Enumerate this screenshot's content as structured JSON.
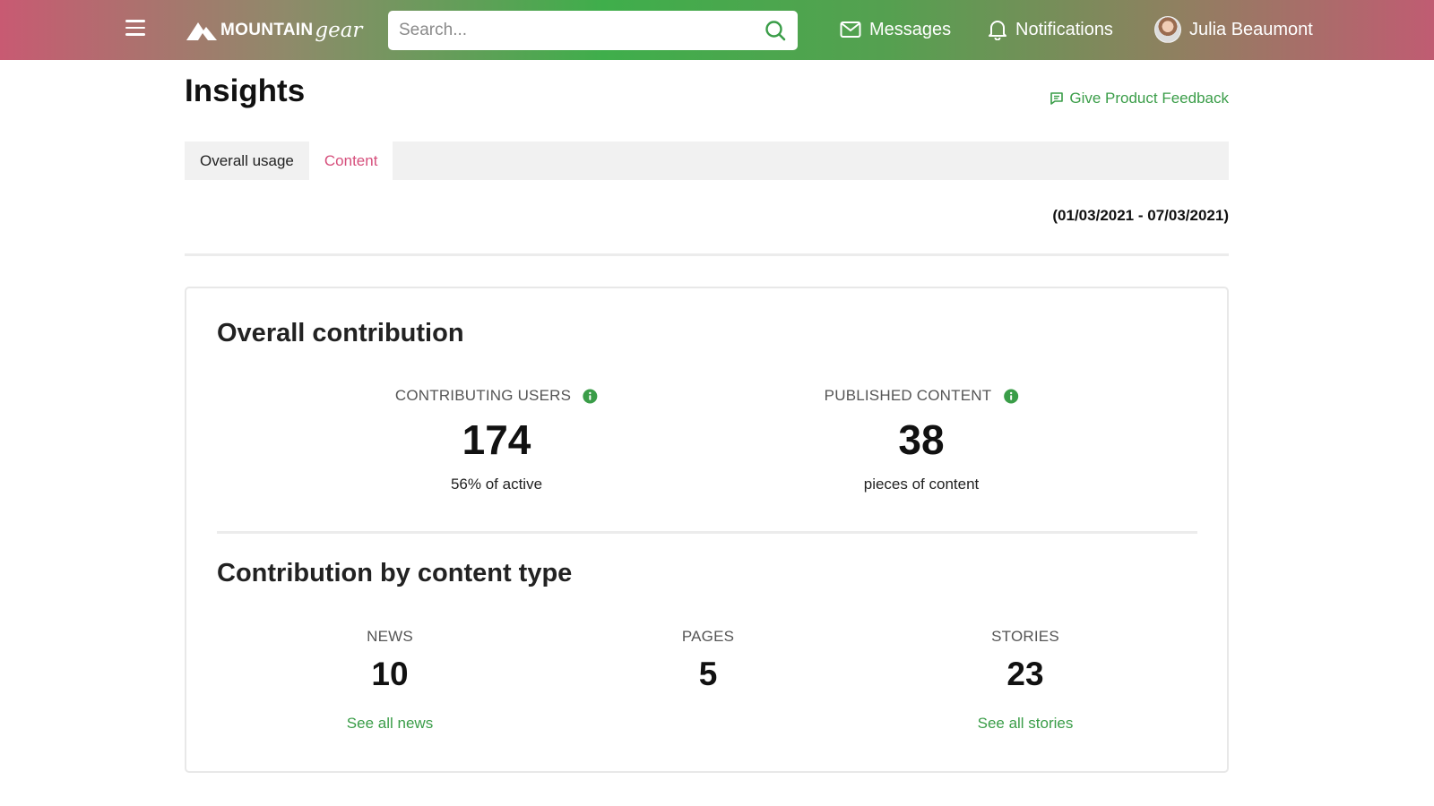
{
  "header": {
    "brand_main": "MOUNTAIN",
    "brand_script": "gear",
    "search_placeholder": "Search...",
    "messages_label": "Messages",
    "notifications_label": "Notifications",
    "user_name": "Julia Beaumont"
  },
  "page": {
    "title": "Insights",
    "feedback_label": "Give Product Feedback",
    "date_range": "(01/03/2021 - 07/03/2021)"
  },
  "tabs": [
    {
      "label": "Overall usage",
      "active": false
    },
    {
      "label": "Content",
      "active": true
    }
  ],
  "overall": {
    "title": "Overall contribution",
    "contributing_users": {
      "label": "CONTRIBUTING USERS",
      "value": "174",
      "sub": "56% of active"
    },
    "published_content": {
      "label": "PUBLISHED CONTENT",
      "value": "38",
      "sub": "pieces of content"
    }
  },
  "by_type": {
    "title": "Contribution by content type",
    "news": {
      "label": "NEWS",
      "value": "10",
      "link": "See all news"
    },
    "pages": {
      "label": "PAGES",
      "value": "5"
    },
    "stories": {
      "label": "STORIES",
      "value": "23",
      "link": "See all stories"
    }
  },
  "colors": {
    "accent_green": "#3a9d48",
    "active_tab": "#d64f7c"
  }
}
